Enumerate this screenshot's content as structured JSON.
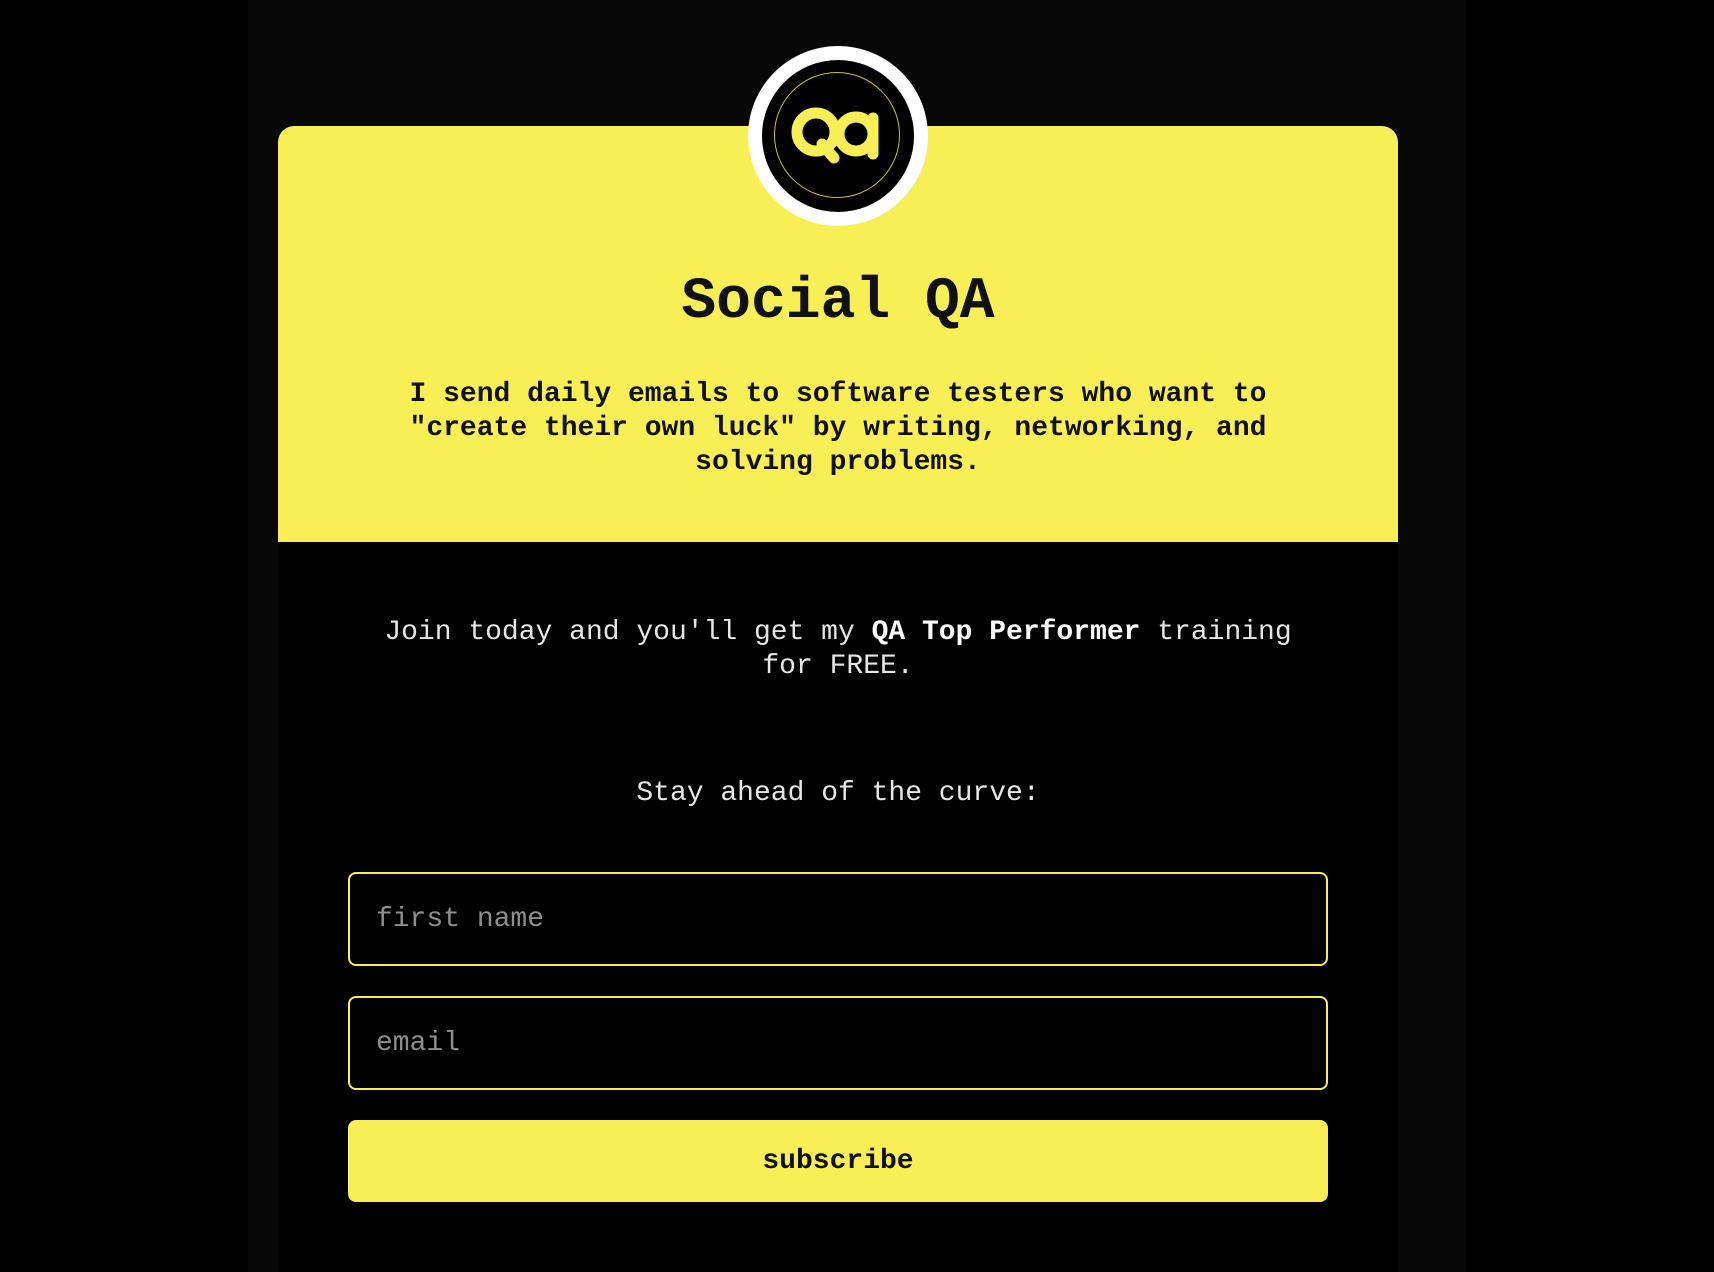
{
  "brand": {
    "logo_icon": "qa-logo-icon",
    "accent_color": "#f8ee55",
    "background_color": "#000000"
  },
  "header": {
    "title": "Social QA",
    "subtitle": "I send daily emails to software testers who want to \"create their own luck\" by writing, networking, and solving problems."
  },
  "promo": {
    "prefix": "Join today and you'll get my ",
    "highlight": "QA Top Performer",
    "suffix": " training for FREE."
  },
  "form": {
    "heading": "Stay ahead of the curve:",
    "first_name_placeholder": "first name",
    "first_name_value": "",
    "email_placeholder": "email",
    "email_value": "",
    "submit_label": "subscribe"
  }
}
